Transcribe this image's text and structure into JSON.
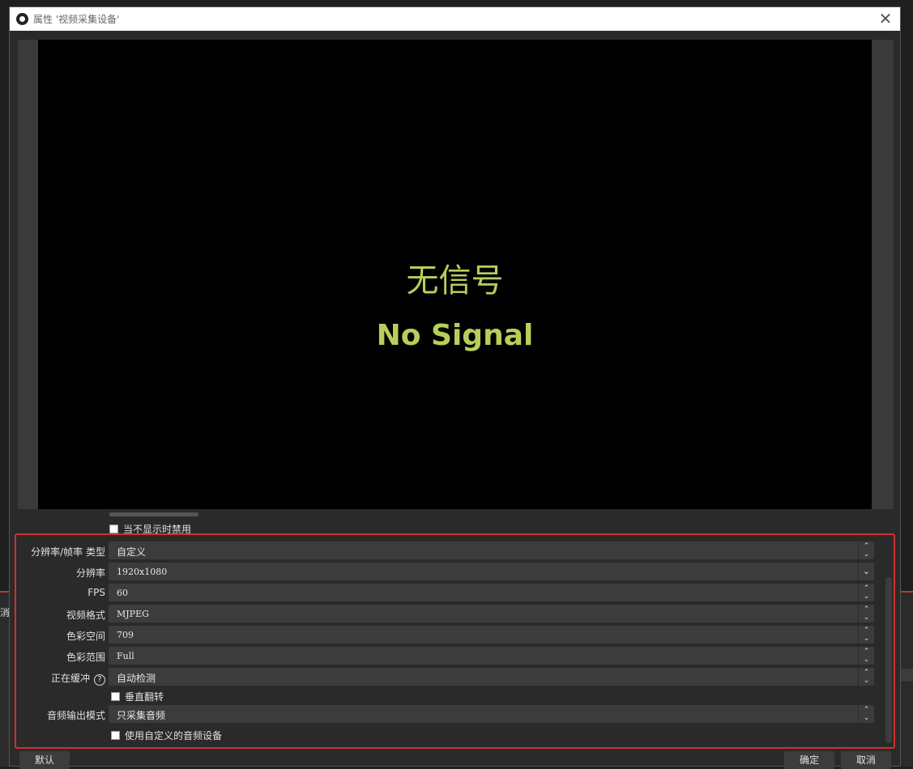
{
  "window": {
    "title": "属性 '视频采集设备'",
    "close_glyph": "✕"
  },
  "preview": {
    "text_cn": "无信号",
    "text_en": "No Signal"
  },
  "top_checkbox": {
    "label": "当不显示时禁用",
    "checked": false
  },
  "properties": [
    {
      "label": "分辨率/帧率 类型",
      "value": "自定义",
      "control": "spin"
    },
    {
      "label": "分辨率",
      "value": "1920x1080",
      "control": "drop"
    },
    {
      "label": "FPS",
      "value": "60",
      "control": "spin"
    },
    {
      "label": "视频格式",
      "value": "MJPEG",
      "control": "spin"
    },
    {
      "label": "色彩空间",
      "value": "709",
      "control": "spin"
    },
    {
      "label": "色彩范围",
      "value": "Full",
      "control": "spin"
    },
    {
      "label": "正在缓冲",
      "value": "自动检测",
      "control": "spin",
      "help": "?"
    }
  ],
  "flip_checkbox": {
    "label": "垂直翻转",
    "checked": false
  },
  "audio_mode": {
    "label": "音频输出模式",
    "value": "只采集音频"
  },
  "custom_audio_checkbox": {
    "label": "使用自定义的音频设备",
    "checked": false
  },
  "buttons": {
    "defaults": "默认",
    "ok": "确定",
    "cancel": "取消"
  },
  "backdrop": {
    "left_text": "消"
  },
  "colors": {
    "signal_text": "#b7cf5a",
    "highlight_border": "#d32f2f"
  }
}
